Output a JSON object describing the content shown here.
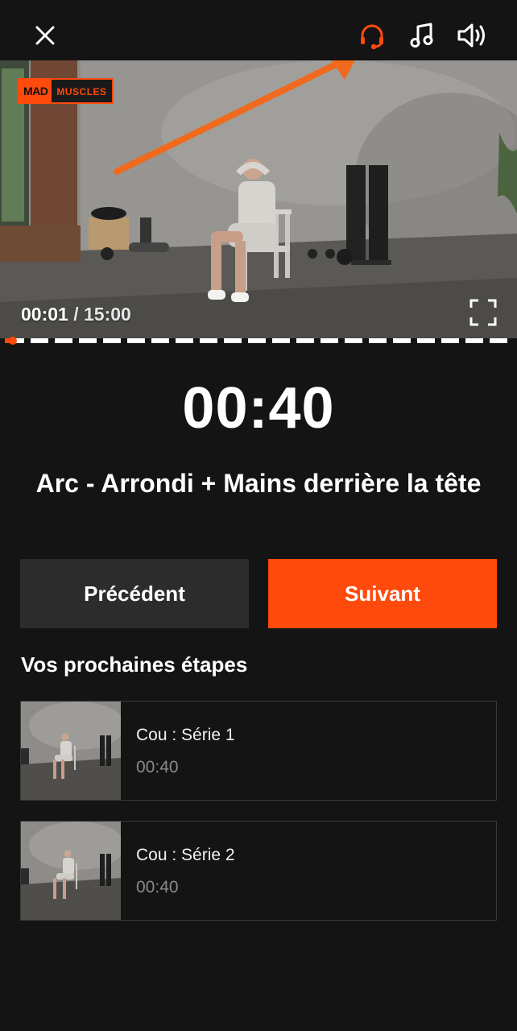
{
  "header": {
    "close_icon": "close-icon",
    "headphones_icon": "headphones-icon",
    "music_icon": "music-note-icon",
    "volume_icon": "volume-icon",
    "accent_color": "#ff4a0d"
  },
  "video": {
    "brand_left": "MAD",
    "brand_right": "MUSCLES",
    "current_time": "00:01",
    "separator": " / ",
    "total_time": "15:00",
    "fullscreen_icon": "fullscreen-icon",
    "progress_fraction": 0.001
  },
  "workout": {
    "timer": "00:40",
    "exercise_name": "Arc - Arrondi + Mains derrière la tête"
  },
  "controls": {
    "previous_label": "Précédent",
    "next_label": "Suivant"
  },
  "next_steps": {
    "title": "Vos prochaines étapes",
    "items": [
      {
        "name": "Cou : Série 1",
        "duration": "00:40"
      },
      {
        "name": "Cou : Série 2",
        "duration": "00:40"
      }
    ]
  }
}
